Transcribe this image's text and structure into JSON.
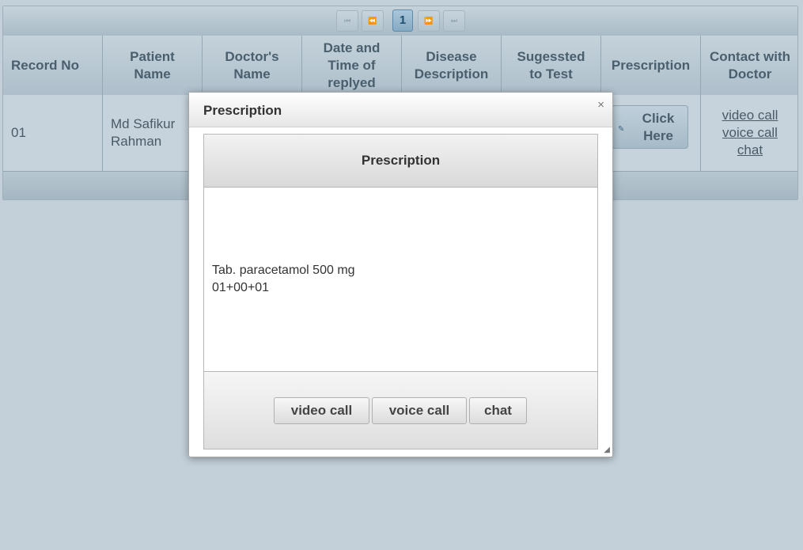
{
  "pager": {
    "first_icon": "first-page-icon",
    "prev_icon": "prev-page-icon",
    "current_page": "1",
    "next_icon": "next-page-icon",
    "last_icon": "last-page-icon",
    "first_glyph": "⏮",
    "prev_glyph": "⏪",
    "next_glyph": "⏩",
    "last_glyph": "⏭"
  },
  "table": {
    "headers": [
      "Record No",
      "Patient Name",
      "Doctor's Name",
      "Date and Time of replyed",
      "Disease Description",
      "Sugessted to Test",
      "Prescription",
      "Contact with Doctor"
    ],
    "rows": [
      {
        "record_no": "01",
        "patient_name": "Md Safikur Rahman",
        "prescription_button": "Click Here",
        "contact_links": [
          "video call",
          "voice call",
          "chat"
        ]
      }
    ]
  },
  "dialog": {
    "title": "Prescription",
    "close_glyph": "×",
    "section_title": "Prescription",
    "lines": [
      "Tab. paracetamol 500 mg",
      "01+00+01"
    ],
    "buttons": [
      "video call",
      "voice call",
      "chat"
    ],
    "resize_glyph": "◢"
  }
}
